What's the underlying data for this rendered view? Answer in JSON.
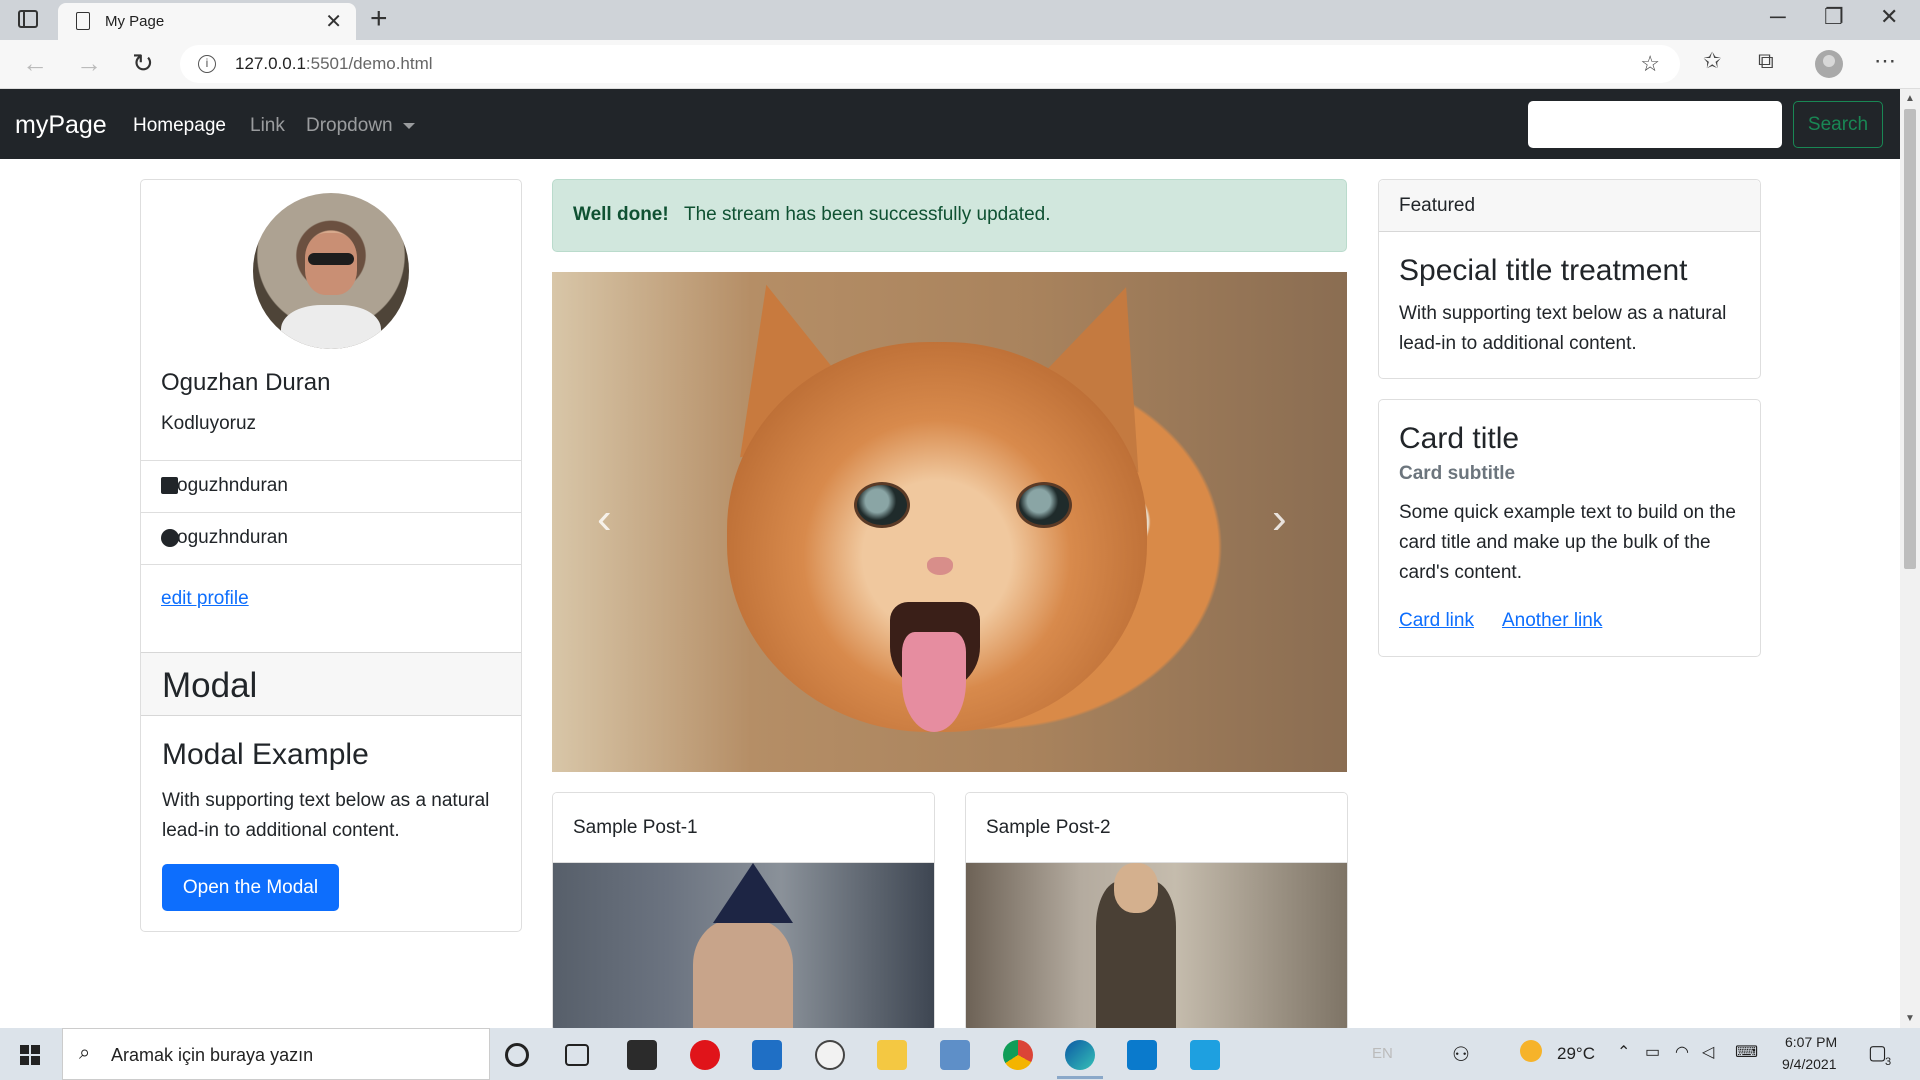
{
  "browser": {
    "tab_title": "My Page",
    "url_host": "127.0.0.1",
    "url_path": ":5501/demo.html"
  },
  "navbar": {
    "brand": "myPage",
    "links": [
      "Homepage",
      "Link",
      "Dropdown"
    ],
    "search_placeholder": "",
    "search_button": "Search"
  },
  "profile": {
    "name": "Oguzhan Duran",
    "subtitle": "Kodluyoruz",
    "twitter": "oguzhnduran",
    "github": "oguzhnduran",
    "edit_link": "edit profile"
  },
  "modal_card": {
    "header": "Modal",
    "title": "Modal Example",
    "text": "With supporting text below as a natural lead-in to additional content.",
    "button": "Open the Modal"
  },
  "alert": {
    "strong": "Well done!",
    "text": "The stream has been successfully updated."
  },
  "carousel": {
    "prev": "‹",
    "next": "›"
  },
  "posts": [
    {
      "title": "Sample Post-1"
    },
    {
      "title": "Sample Post-2"
    }
  ],
  "featured": {
    "header": "Featured",
    "title": "Special title treatment",
    "text": "With supporting text below as a natural lead-in to additional content."
  },
  "info_card": {
    "title": "Card title",
    "subtitle": "Card subtitle",
    "text": "Some quick example text to build on the card title and make up the bulk of the card's content.",
    "link1": "Card link",
    "link2": "Another link"
  },
  "taskbar": {
    "search_placeholder": "Aramak için buraya yazın",
    "lang": "EN",
    "temperature": "29°C",
    "time": "6:07 PM",
    "date": "9/4/2021",
    "notifications": "3"
  },
  "colors": {
    "navbar_bg": "#212529",
    "primary": "#0d6efd",
    "success": "#198754",
    "alert_bg": "#d1e7dd",
    "alert_text": "#0f5132"
  },
  "icons": [
    "tab-actions-icon",
    "page-icon",
    "close-icon",
    "new-tab-icon",
    "minimize-icon",
    "maximize-icon",
    "window-close-icon",
    "back-icon",
    "forward-icon",
    "reload-icon",
    "info-icon",
    "add-favorite-icon",
    "favorites-icon",
    "collections-icon",
    "profile-icon",
    "more-icon",
    "twitter-icon",
    "github-icon",
    "windows-start-icon",
    "search-icon"
  ]
}
